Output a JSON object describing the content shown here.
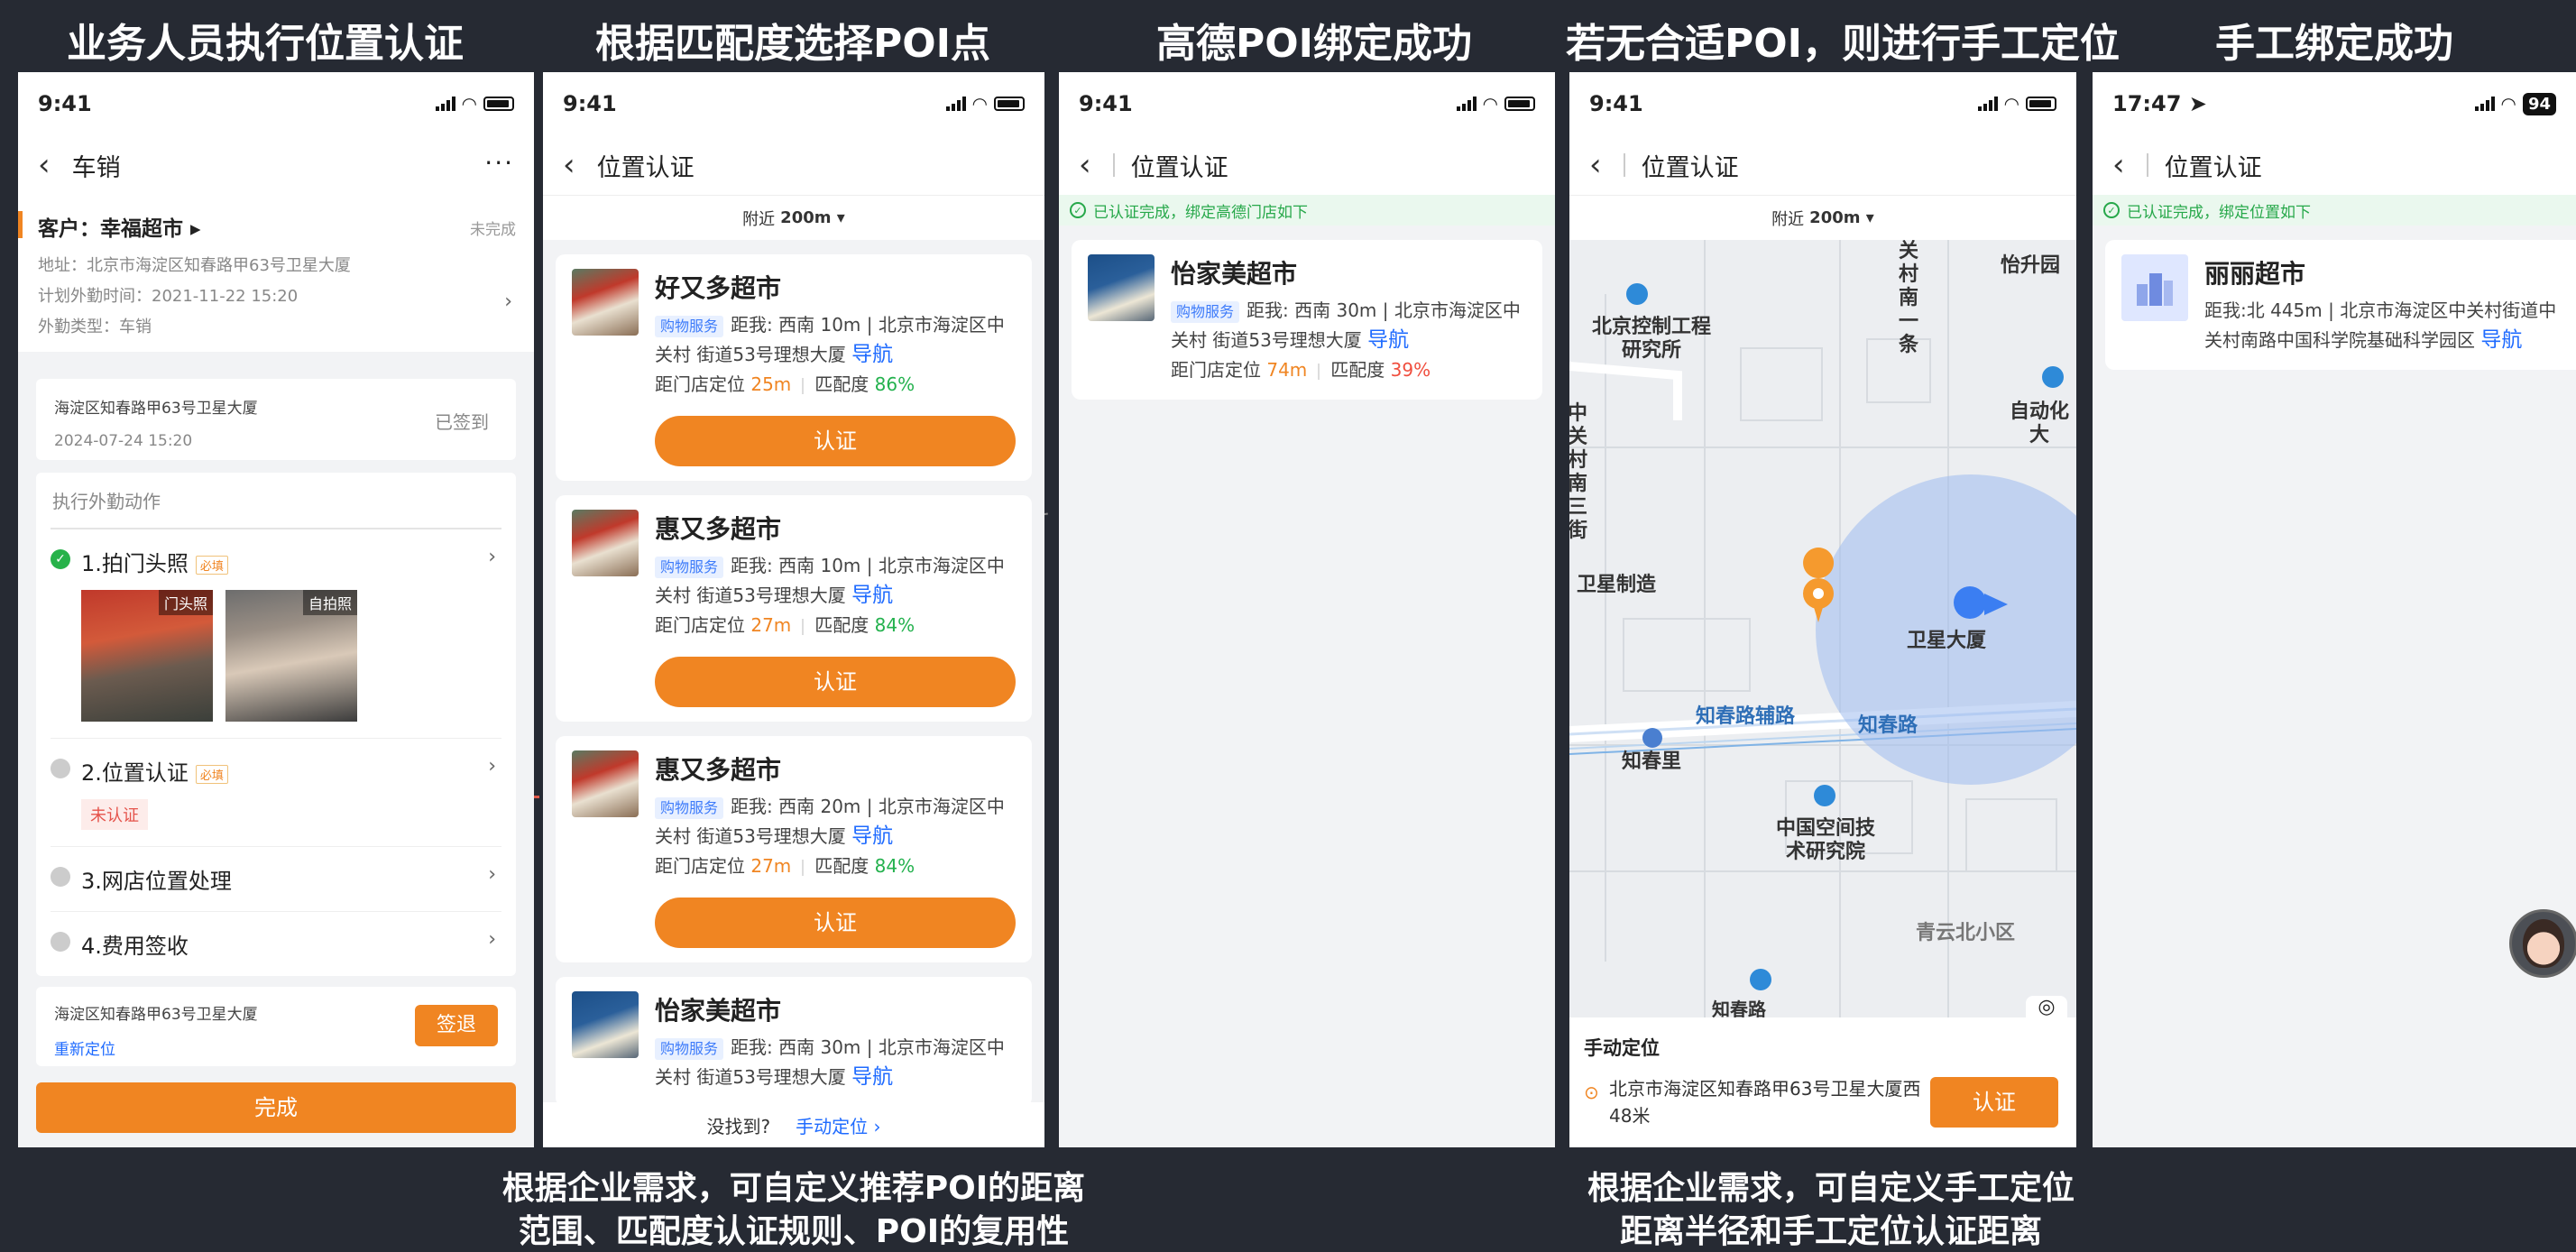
{
  "titles": [
    "业务人员执行位置认证",
    "根据匹配度选择POI点",
    "高德POI绑定成功",
    "若无合适POI，则进行手工定位",
    "手工绑定成功"
  ],
  "captions": {
    "left": [
      "根据企业需求，可自定义推荐POI的距离",
      "范围、匹配度认证规则、POI的复用性"
    ],
    "right": [
      "根据企业需求，可自定义手工定位",
      "距离半径和手工定位认证距离"
    ]
  },
  "status_time": "9:41",
  "status_time_last": "17:47",
  "battery_last": "94",
  "nav": {
    "p1": "车销",
    "p1_more": "···",
    "cert": "位置认证"
  },
  "nearby": {
    "label": "附近",
    "value": "200m ▾"
  },
  "phone1": {
    "customer": "客户：幸福超市 ▸",
    "status": "未完成",
    "address": "地址：北京市海淀区知春路甲63号卫星大厦",
    "plan_time": "计划外勤时间：2021-11-22 15:20",
    "type": "外勤类型：车销",
    "signed_addr": "海淀区知春路甲63号卫星大厦",
    "signed_time": "2024-07-24 15:20",
    "signed_status": "已签到",
    "actions_head": "执行外勤动作",
    "items": [
      {
        "label": "1.拍门头照",
        "required": "必填"
      },
      {
        "label": "2.位置认证",
        "required": "必填",
        "state": "未认证"
      },
      {
        "label": "3.网店位置处理"
      },
      {
        "label": "4.费用签收"
      }
    ],
    "photo_labels": [
      "门头照",
      "自拍照"
    ],
    "bottom_addr": "海淀区知春路甲63号卫星大厦",
    "relocate": "重新定位",
    "signout": "签退",
    "done": "完成"
  },
  "phone2": {
    "pois": [
      {
        "name": "好又多超市",
        "tag": "购物服务",
        "line1": "距我: 西南 10m | 北京市海淀区中",
        "line2": "关村 街道53号理想大厦",
        "nav": "导航",
        "dist_label": "距门店定位",
        "dist": "25m",
        "match_label": "匹配度",
        "match": "86%",
        "btn": "认证"
      },
      {
        "name": "惠又多超市",
        "tag": "购物服务",
        "line1": "距我: 西南 10m | 北京市海淀区中",
        "line2": "关村 街道53号理想大厦",
        "nav": "导航",
        "dist_label": "距门店定位",
        "dist": "27m",
        "match_label": "匹配度",
        "match": "84%",
        "btn": "认证"
      },
      {
        "name": "惠又多超市",
        "tag": "购物服务",
        "line1": "距我: 西南 20m | 北京市海淀区中",
        "line2": "关村 街道53号理想大厦",
        "nav": "导航",
        "dist_label": "距门店定位",
        "dist": "27m",
        "match_label": "匹配度",
        "match": "84%",
        "btn": "认证"
      },
      {
        "name": "怡家美超市",
        "tag": "购物服务",
        "line1": "距我: 西南 30m | 北京市海淀区中",
        "line2": "关村 街道53号理想大厦",
        "nav": "导航"
      }
    ],
    "not_found": "没找到?",
    "manual": "手动定位 ›"
  },
  "phone3": {
    "ok": "已认证完成，绑定高德门店如下",
    "poi": {
      "name": "怡家美超市",
      "tag": "购物服务",
      "line1": "距我: 西南 30m | 北京市海淀区中",
      "line2": "关村 街道53号理想大厦",
      "nav": "导航",
      "dist_label": "距门店定位",
      "dist": "74m",
      "match_label": "匹配度",
      "match": "39%"
    }
  },
  "phone4": {
    "map_labels": [
      "北京控制工程研究所",
      "关村南一条",
      "怡升园",
      "自动化大",
      "中关村南三街",
      "卫星制造",
      "卫星大厦",
      "知春路辅路",
      "知春路",
      "知春里",
      "中国空间技术研究院",
      "青云北小区",
      "知春路"
    ],
    "manual_title": "手动定位",
    "manual_addr": "北京市海淀区知春路甲63号卫星大厦西48米",
    "btn": "认证"
  },
  "phone5": {
    "ok": "已认证完成，绑定位置如下",
    "name": "丽丽超市",
    "line1": "距我:北 445m | 北京市海淀区中关村街道中",
    "line2": "关村南路中国科学院基础科学园区",
    "nav": "导航"
  }
}
